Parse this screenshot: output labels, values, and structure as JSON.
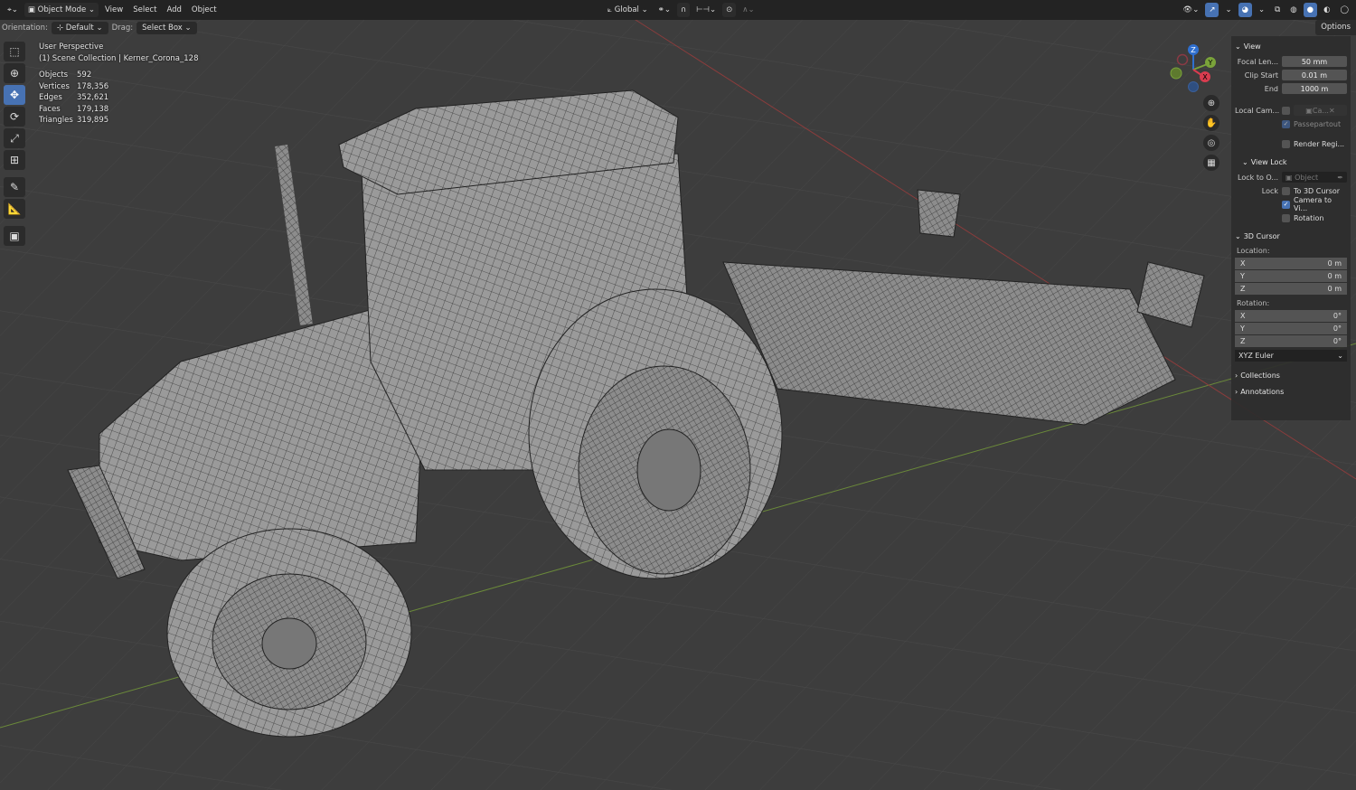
{
  "header": {
    "mode": "Object Mode",
    "menus": [
      "View",
      "Select",
      "Add",
      "Object"
    ],
    "transform_orientation": "Global"
  },
  "toolrow": {
    "orientation_label": "Orientation:",
    "orientation_value": "Default",
    "drag_label": "Drag:",
    "drag_value": "Select Box",
    "options": "Options"
  },
  "overlay": {
    "perspective": "User Perspective",
    "collection": "(1) Scene Collection | Kerner_Corona_128",
    "stats": [
      {
        "k": "Objects",
        "v": "592"
      },
      {
        "k": "Vertices",
        "v": "178,356"
      },
      {
        "k": "Edges",
        "v": "352,621"
      },
      {
        "k": "Faces",
        "v": "179,138"
      },
      {
        "k": "Triangles",
        "v": "319,895"
      }
    ]
  },
  "gizmo": {
    "x": "X",
    "y": "Y",
    "z": "Z"
  },
  "sidebar": {
    "view": {
      "title": "View",
      "focal_label": "Focal Len...",
      "focal": "50 mm",
      "clip_start_label": "Clip Start",
      "clip_start": "0.01 m",
      "end_label": "End",
      "end": "1000 m",
      "local_cam_label": "Local Cam...",
      "local_cam": "Ca...",
      "passepartout": "Passepartout",
      "render_region": "Render Regi..."
    },
    "view_lock": {
      "title": "View Lock",
      "lock_to_label": "Lock to O...",
      "lock_to": "Object",
      "lock_label": "Lock",
      "to_cursor": "To 3D Cursor",
      "camera_to_view": "Camera to Vi...",
      "rotation": "Rotation"
    },
    "cursor": {
      "title": "3D Cursor",
      "location_label": "Location:",
      "loc": [
        {
          "a": "X",
          "v": "0 m"
        },
        {
          "a": "Y",
          "v": "0 m"
        },
        {
          "a": "Z",
          "v": "0 m"
        }
      ],
      "rotation_label": "Rotation:",
      "rot": [
        {
          "a": "X",
          "v": "0°"
        },
        {
          "a": "Y",
          "v": "0°"
        },
        {
          "a": "Z",
          "v": "0°"
        }
      ],
      "rotation_mode": "XYZ Euler"
    },
    "collections": "Collections",
    "annotations": "Annotations"
  }
}
